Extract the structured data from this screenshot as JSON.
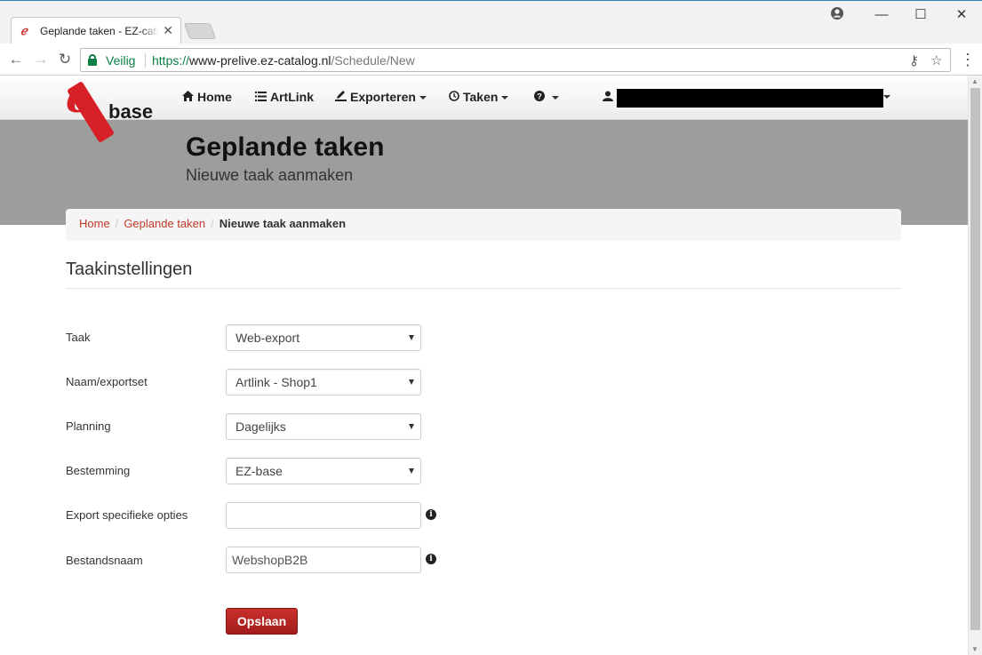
{
  "browser": {
    "tab_title": "Geplande taken - EZ-catalog",
    "secure_label": "Veilig",
    "url_scheme": "https://",
    "url_host": "www-prelive.ez-catalog.nl",
    "url_path": "/Schedule/New"
  },
  "logo": {
    "letter": "e",
    "word": "base"
  },
  "nav": {
    "home": "Home",
    "artlink": "ArtLink",
    "exporteren": "Exporteren",
    "taken": "Taken"
  },
  "header": {
    "title": "Geplande taken",
    "subtitle": "Nieuwe taak aanmaken"
  },
  "breadcrumb": {
    "home": "Home",
    "geplande": "Geplande taken",
    "current": "Nieuwe taak aanmaken"
  },
  "form": {
    "legend": "Taakinstellingen",
    "taak_label": "Taak",
    "taak_value": "Web-export",
    "naam_label": "Naam/exportset",
    "naam_value": "Artlink - Shop1",
    "planning_label": "Planning",
    "planning_value": "Dagelijks",
    "bestemming_label": "Bestemming",
    "bestemming_value": "EZ-base",
    "opties_label": "Export specifieke opties",
    "opties_value": "",
    "bestandsnaam_label": "Bestandsnaam",
    "bestandsnaam_value": "WebshopB2B",
    "save_label": "Opslaan"
  },
  "colors": {
    "accent_red": "#c0392b",
    "header_gray": "#9d9d9b",
    "secure_green": "#0b8043"
  }
}
